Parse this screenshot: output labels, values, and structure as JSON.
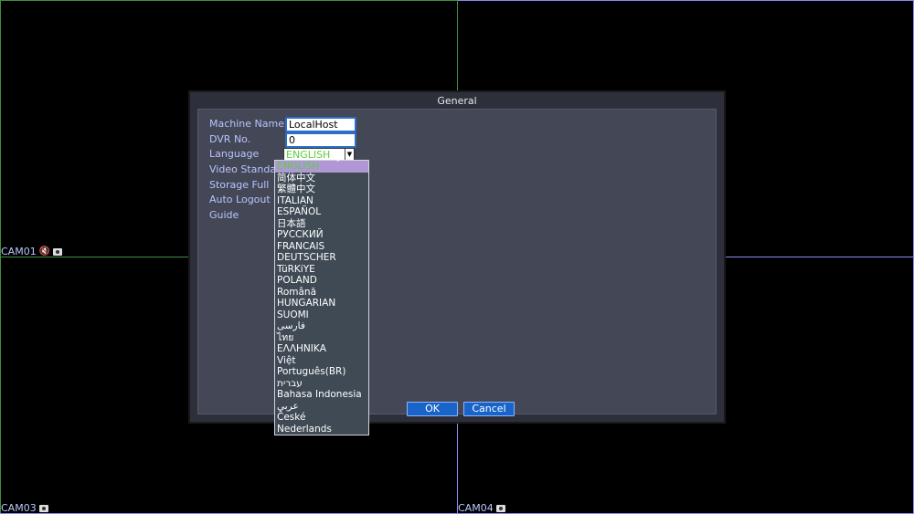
{
  "cameras": {
    "cam01": "CAM01",
    "cam03": "CAM03",
    "cam04": "CAM04"
  },
  "dialog": {
    "title": "General",
    "labels": {
      "machine_name": "Machine Name",
      "dvr_no": "DVR No.",
      "language": "Language",
      "video_standard": "Video Standard",
      "storage_full": "Storage Full",
      "auto_logout": "Auto Logout",
      "guide": "Guide"
    },
    "fields": {
      "machine_name_value": "LocalHost",
      "dvr_no_value": "0",
      "language_value": "ENGLISH"
    },
    "buttons": {
      "ok": "OK",
      "cancel": "Cancel"
    }
  },
  "language_options": [
    "ENGLISH",
    "简体中文",
    "繁體中文",
    "ITALIAN",
    "ESPAÑOL",
    "日本語",
    "РУССКИЙ",
    "FRANCAIS",
    "DEUTSCHER",
    "TüRKiYE",
    "POLAND",
    "Română",
    "HUNGARIAN",
    "SUOMI",
    "فارسی",
    "ไทย",
    "ΕΛΛΗΝΙΚΑ",
    "Việt",
    "Português(BR)",
    "עברית",
    "Bahasa Indonesia",
    "عربي",
    "České",
    "Nederlands"
  ],
  "colors": {
    "selected_text": "#5bcf3c",
    "selected_bg": "#b197d6",
    "button_bg": "#1864c8",
    "label_color": "#b8c4ff"
  }
}
